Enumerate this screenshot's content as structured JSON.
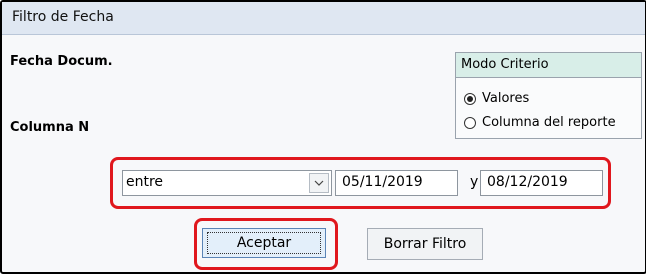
{
  "window": {
    "title": "Filtro de Fecha"
  },
  "fields": {
    "fecha_label": "Fecha Docum.",
    "columna_label": "Columna N"
  },
  "modo_criterio": {
    "title": "Modo Criterio",
    "options": [
      {
        "label": "Valores",
        "selected": true
      },
      {
        "label": "Columna del reporte",
        "selected": false
      }
    ]
  },
  "filter": {
    "operator": "entre",
    "from": "05/11/2019",
    "connector": "y",
    "to": "08/12/2019"
  },
  "buttons": {
    "accept": "Aceptar",
    "clear": "Borrar Filtro"
  },
  "icons": {
    "dropdown": "chevron-down-icon",
    "radio_selected": "radio-selected-icon",
    "radio_unselected": "radio-unselected-icon"
  },
  "colors": {
    "highlight": "#e0171d",
    "titlebar": "#dfe7f2",
    "group_header": "#d8eee8"
  }
}
